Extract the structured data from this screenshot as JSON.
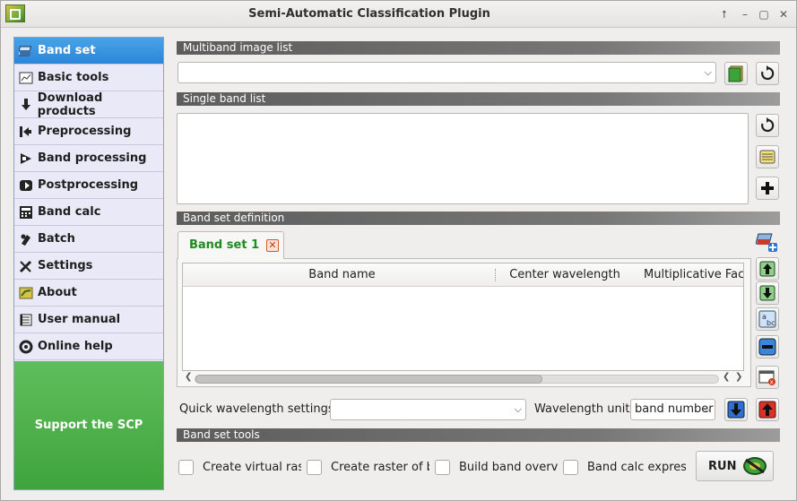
{
  "window": {
    "title": "Semi-Automatic Classification Plugin"
  },
  "sidebar": {
    "items": [
      {
        "label": "Band set",
        "icon": "band-set-icon",
        "active": true
      },
      {
        "label": "Basic tools",
        "icon": "basic-tools-icon"
      },
      {
        "label": "Download products",
        "icon": "download-icon"
      },
      {
        "label": "Preprocessing",
        "icon": "preprocessing-icon"
      },
      {
        "label": "Band processing",
        "icon": "band-processing-icon"
      },
      {
        "label": "Postprocessing",
        "icon": "postprocessing-icon"
      },
      {
        "label": "Band calc",
        "icon": "band-calc-icon"
      },
      {
        "label": "Batch",
        "icon": "batch-icon"
      },
      {
        "label": "Settings",
        "icon": "settings-icon"
      },
      {
        "label": "About",
        "icon": "about-icon"
      },
      {
        "label": "User manual",
        "icon": "user-manual-icon"
      },
      {
        "label": "Online help",
        "icon": "online-help-icon"
      }
    ],
    "support_label": "Support the SCP"
  },
  "multiband": {
    "header": "Multiband image list",
    "value": ""
  },
  "singleband": {
    "header": "Single band list"
  },
  "bandset_def": {
    "header": "Band set definition",
    "tab_label": "Band set 1",
    "columns": [
      "Band name",
      "Center wavelength",
      "Multiplicative Fact"
    ]
  },
  "quick_wavelength": {
    "label": "Quick wavelength settings",
    "value": ""
  },
  "wavelength_unit": {
    "label": "Wavelength unit",
    "value": "band number"
  },
  "tools": {
    "header": "Band set tools",
    "checkboxes": [
      "Create virtual rast",
      "Create raster of ba",
      "Build band overvie",
      "Band calc express"
    ],
    "run_label": "RUN"
  },
  "colors": {
    "accent": "#2d86d6",
    "support_green": "#4bb048",
    "tab_green": "#1f8a1f"
  }
}
